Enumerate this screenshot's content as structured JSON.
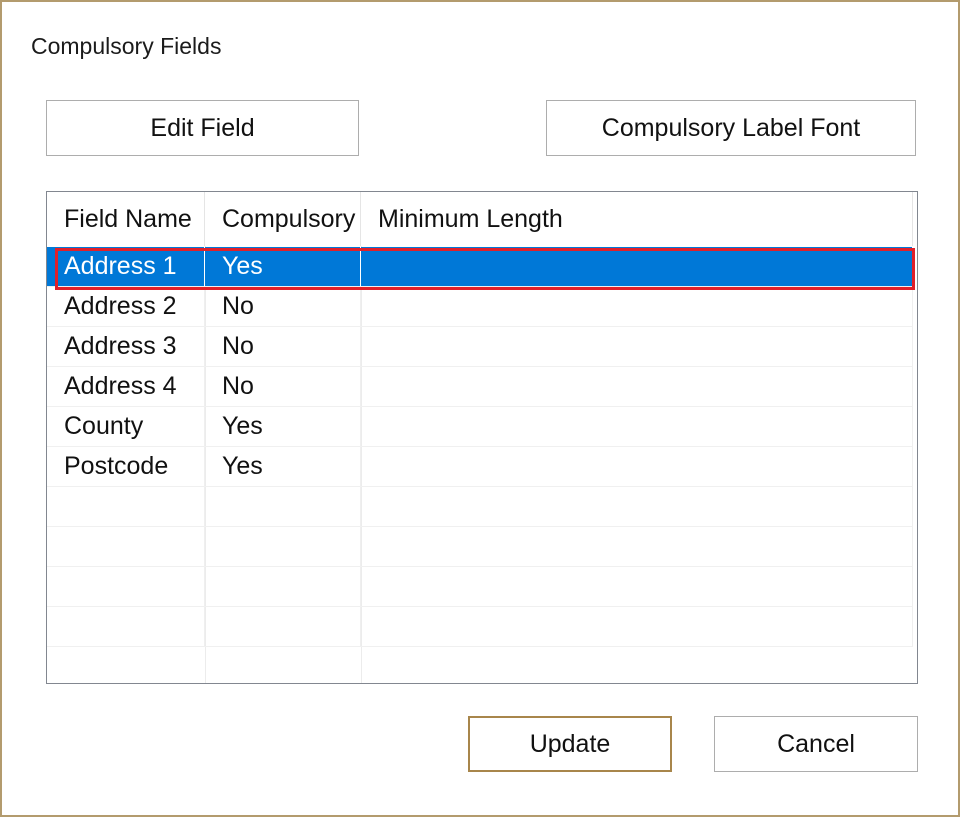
{
  "dialog": {
    "title": "Compulsory Fields",
    "edit_field_label": "Edit Field",
    "label_font_label": "Compulsory Label Font",
    "update_label": "Update",
    "cancel_label": "Cancel"
  },
  "table": {
    "columns": [
      "Field Name",
      "Compulsory",
      "Minimum Length"
    ],
    "rows": [
      {
        "field": "Address 1",
        "compulsory": "Yes",
        "min_length": "",
        "selected": true
      },
      {
        "field": "Address 2",
        "compulsory": "No",
        "min_length": ""
      },
      {
        "field": "Address 3",
        "compulsory": "No",
        "min_length": ""
      },
      {
        "field": "Address 4",
        "compulsory": "No",
        "min_length": ""
      },
      {
        "field": "County",
        "compulsory": "Yes",
        "min_length": ""
      },
      {
        "field": "Postcode",
        "compulsory": "Yes",
        "min_length": ""
      }
    ]
  },
  "colors": {
    "selection": "#0078d7",
    "highlight_outline": "#e0202a",
    "dialog_border": "#b39b6e"
  }
}
